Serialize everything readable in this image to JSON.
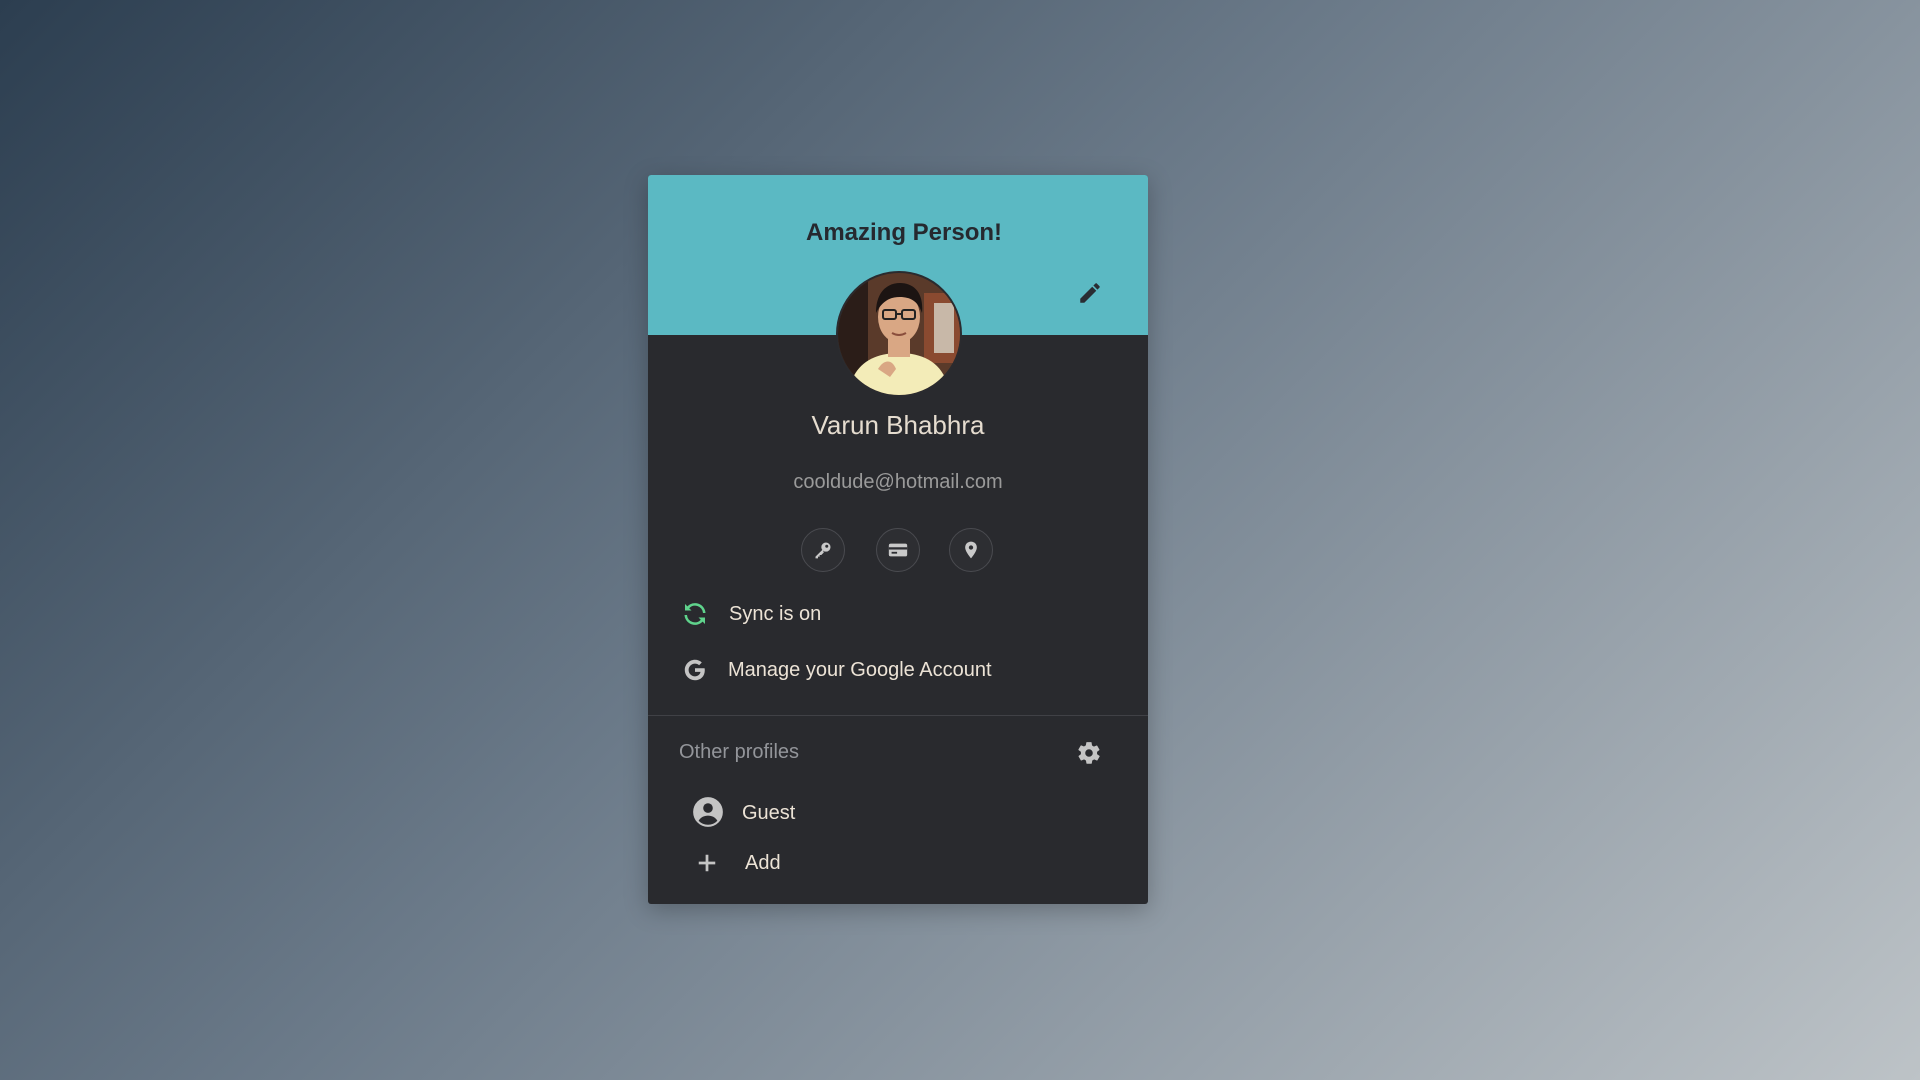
{
  "card": {
    "title": "Amazing Person!",
    "profile": {
      "name": "Varun Bhabhra",
      "email": "cooldude@hotmail.com"
    },
    "quick_actions": [
      {
        "icon": "key-icon",
        "name": "passwords"
      },
      {
        "icon": "credit-card-icon",
        "name": "payment-methods"
      },
      {
        "icon": "location-pin-icon",
        "name": "addresses"
      }
    ],
    "menu": {
      "sync_label": "Sync is on",
      "manage_label": "Manage your Google Account"
    },
    "other_profiles": {
      "title": "Other profiles",
      "items": [
        {
          "label": "Guest",
          "icon": "account-circle-icon"
        },
        {
          "label": "Add",
          "icon": "plus-icon"
        }
      ]
    }
  },
  "colors": {
    "background_gradient": [
      "#2c3e50",
      "#bdc3c7"
    ],
    "header": "#5bb9c3",
    "card_body": "#292a2e",
    "sync_accent": "#5fd38c",
    "text_primary": "#ece3d6",
    "text_secondary": "#9a9a9a"
  }
}
